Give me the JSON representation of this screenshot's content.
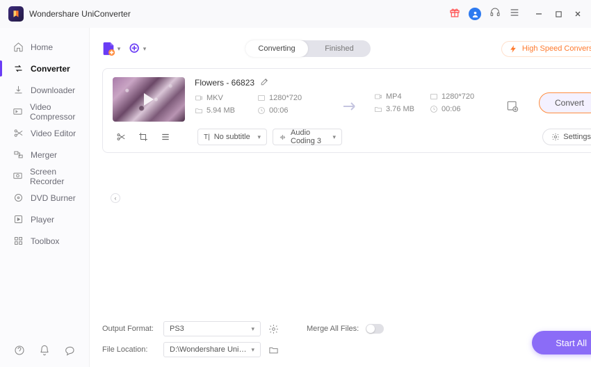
{
  "app": {
    "title": "Wondershare UniConverter"
  },
  "sidebar": {
    "items": [
      {
        "label": "Home"
      },
      {
        "label": "Converter"
      },
      {
        "label": "Downloader"
      },
      {
        "label": "Video Compressor"
      },
      {
        "label": "Video Editor"
      },
      {
        "label": "Merger"
      },
      {
        "label": "Screen Recorder"
      },
      {
        "label": "DVD Burner"
      },
      {
        "label": "Player"
      },
      {
        "label": "Toolbox"
      }
    ]
  },
  "tabs": {
    "converting": "Converting",
    "finished": "Finished"
  },
  "highSpeed": "High Speed Conversion",
  "file": {
    "title": "Flowers - 66823",
    "in": {
      "format": "MKV",
      "resolution": "1280*720",
      "size": "5.94 MB",
      "duration": "00:06"
    },
    "out": {
      "format": "MP4",
      "resolution": "1280*720",
      "size": "3.76 MB",
      "duration": "00:06"
    },
    "subtitle": "No subtitle",
    "audio": "Audio Coding 3",
    "settings": "Settings",
    "convert": "Convert"
  },
  "bottom": {
    "outputFormatLabel": "Output Format:",
    "outputFormat": "PS3",
    "fileLocationLabel": "File Location:",
    "fileLocation": "D:\\Wondershare UniConverter",
    "mergeLabel": "Merge All Files:",
    "startAll": "Start All"
  }
}
